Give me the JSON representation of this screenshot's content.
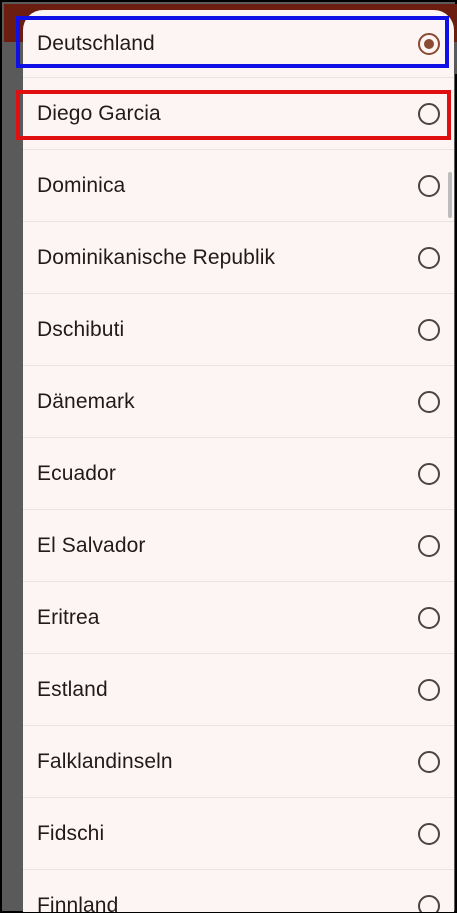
{
  "dialog": {
    "items": [
      {
        "label": "Deutschland",
        "selected": true
      },
      {
        "label": "Diego Garcia",
        "selected": false
      },
      {
        "label": "Dominica",
        "selected": false
      },
      {
        "label": "Dominikanische Republik",
        "selected": false
      },
      {
        "label": "Dschibuti",
        "selected": false
      },
      {
        "label": "Dänemark",
        "selected": false
      },
      {
        "label": "Ecuador",
        "selected": false
      },
      {
        "label": "El Salvador",
        "selected": false
      },
      {
        "label": "Eritrea",
        "selected": false
      },
      {
        "label": "Estland",
        "selected": false
      },
      {
        "label": "Falklandinseln",
        "selected": false
      },
      {
        "label": "Fidschi",
        "selected": false
      },
      {
        "label": "Finnland",
        "selected": false
      }
    ]
  },
  "colors": {
    "appbar": "#6b1d10",
    "accent": "#8a4a33",
    "dialog_bg": "#fdf5f3",
    "highlight_blue": "#1010e6",
    "highlight_red": "#e01010"
  }
}
